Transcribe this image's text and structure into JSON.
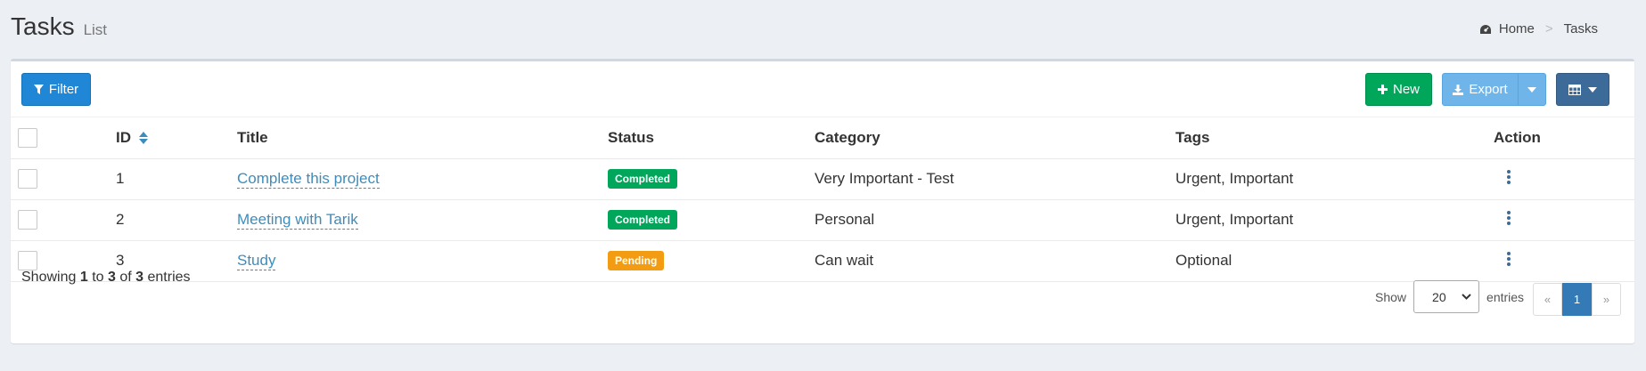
{
  "header": {
    "title": "Tasks",
    "subtitle": "List"
  },
  "breadcrumb": {
    "home": "Home",
    "separator": ">",
    "current": "Tasks",
    "icon": "dashboard-icon"
  },
  "toolbar": {
    "filter_label": "Filter",
    "new_label": "New",
    "export_label": "Export",
    "columns_icon": "table-icon"
  },
  "table": {
    "headers": {
      "id": "ID",
      "title": "Title",
      "status": "Status",
      "category": "Category",
      "tags": "Tags",
      "action": "Action"
    },
    "rows": [
      {
        "id": "1",
        "title": "Complete this project",
        "status": "Completed",
        "category": "Very Important - Test",
        "tags": "Urgent, Important"
      },
      {
        "id": "2",
        "title": "Meeting with Tarik",
        "status": "Completed",
        "category": "Personal",
        "tags": "Urgent, Important"
      },
      {
        "id": "3",
        "title": "Study",
        "status": "Pending",
        "category": "Can wait",
        "tags": "Optional"
      }
    ]
  },
  "footer": {
    "info_prefix": "Showing",
    "info_start": "1",
    "info_to": "to",
    "info_end": "3",
    "info_of": "of",
    "info_total": "3",
    "info_suffix": "entries",
    "show_label": "Show",
    "page_size": "20",
    "entries_label": "entries",
    "prev": "«",
    "current_page": "1",
    "next": "»"
  },
  "colors": {
    "primary": "#1f87d6",
    "success": "#00a65a",
    "warning": "#f39c12",
    "link": "#3c8dbc",
    "dark": "#3c6a99"
  }
}
